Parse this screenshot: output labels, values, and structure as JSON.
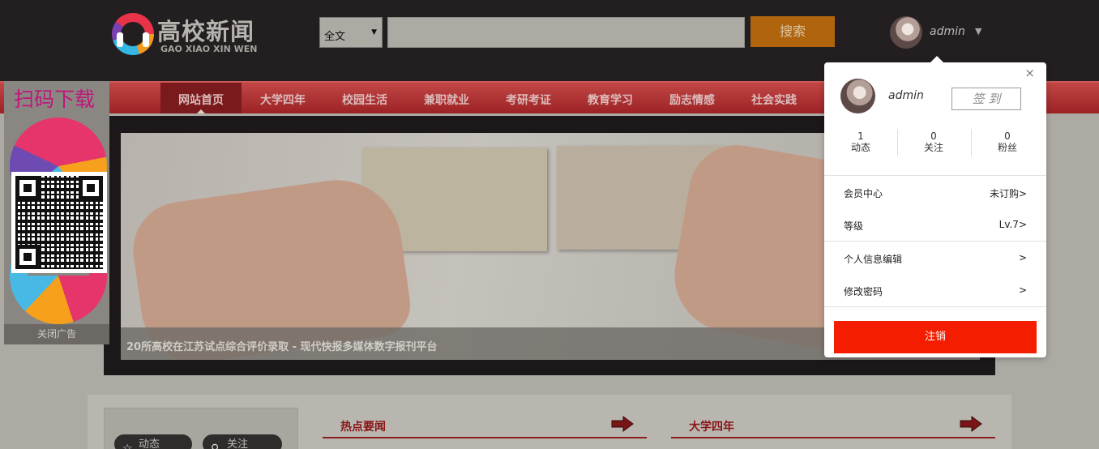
{
  "header": {
    "logo_title": "高校新闻",
    "logo_subtitle": "GAO XIAO XIN WEN",
    "search_scope": "全文",
    "search_placeholder": "",
    "search_button": "搜索",
    "username": "admin"
  },
  "nav": {
    "items": [
      {
        "label": "网站首页",
        "active": true
      },
      {
        "label": "大学四年"
      },
      {
        "label": "校园生活"
      },
      {
        "label": "兼职就业"
      },
      {
        "label": "考研考证"
      },
      {
        "label": "教育学习"
      },
      {
        "label": "励志情感"
      },
      {
        "label": "社会实践"
      }
    ]
  },
  "ad": {
    "title": "扫码下载",
    "close_label": "关闭广告"
  },
  "banner": {
    "caption": "20所高校在江苏试点综合评价录取 - 现代快报多媒体数字报刊平台"
  },
  "lower": {
    "pill_dynamic": "动态",
    "pill_follow": "关注",
    "section_hot": "热点要闻",
    "section_univ": "大学四年"
  },
  "popup": {
    "close": "×",
    "username": "admin",
    "sign_in": "签 到",
    "stats": [
      {
        "value": "1",
        "label": "动态"
      },
      {
        "value": "0",
        "label": "关注"
      },
      {
        "value": "0",
        "label": "粉丝"
      }
    ],
    "member_center": "会员中心",
    "member_status": "未订购>",
    "level": "等级",
    "level_value": "Lv.7>",
    "edit_profile": "个人信息编辑",
    "change_password": "修改密码",
    "chevron": ">",
    "logout": "注销"
  },
  "colors": {
    "header_bg": "#231f20",
    "search_button": "#b0640d",
    "nav_red": "#9c2225",
    "logout_red": "#f41d00"
  }
}
